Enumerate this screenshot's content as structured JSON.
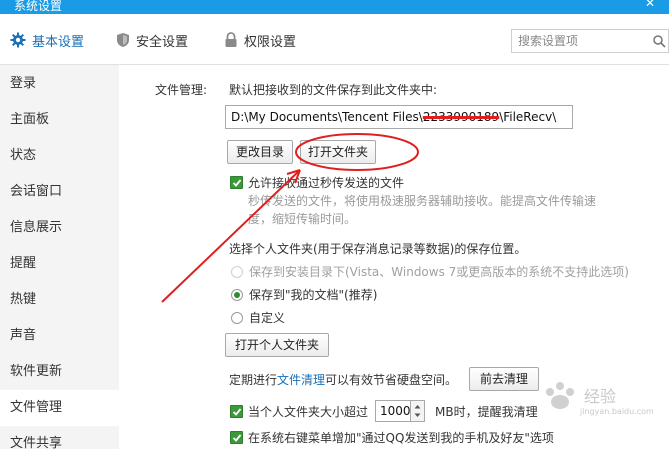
{
  "window": {
    "title": "系统设置",
    "close_glyph": "✕"
  },
  "tabs": [
    {
      "label": "基本设置",
      "icon": "gear-icon",
      "active": true
    },
    {
      "label": "安全设置",
      "icon": "shield-icon",
      "active": false
    },
    {
      "label": "权限设置",
      "icon": "lock-icon",
      "active": false
    }
  ],
  "search": {
    "placeholder": "搜索设置项",
    "icon": "search-icon"
  },
  "sidebar": {
    "items": [
      {
        "label": "登录"
      },
      {
        "label": "主面板"
      },
      {
        "label": "状态"
      },
      {
        "label": "会话窗口"
      },
      {
        "label": "信息展示"
      },
      {
        "label": "提醒"
      },
      {
        "label": "热键"
      },
      {
        "label": "声音"
      },
      {
        "label": "软件更新"
      },
      {
        "label": "文件管理",
        "active": true
      },
      {
        "label": "文件共享"
      }
    ]
  },
  "file_management": {
    "section_label": "文件管理:",
    "save_desc": "默认把接收到的文件保存到此文件夹中:",
    "path_prefix": "D:\\My Documents\\Tencent Files\\",
    "path_hidden": "2233990189",
    "path_suffix": "\\FileRecv\\",
    "change_dir_button": "更改目录",
    "open_folder_button": "打开文件夹",
    "allow_fast_label": "允许接收通过秒传发送的文件",
    "allow_fast_checked": true,
    "allow_fast_desc_1": "秒传发送的文件，将使用极速服务器辅助接收。能提高文件传输速",
    "allow_fast_desc_2": "度，缩短传输时间。",
    "personal_folder_title": "选择个人文件夹(用于保存消息记录等数据)的保存位置。",
    "options": [
      {
        "label": "保存到安装目录下(Vista、Windows 7或更高版本的系统不支持此选项)",
        "disabled": true,
        "selected": false
      },
      {
        "label": "保存到\"我的文档\"(推荐)",
        "disabled": false,
        "selected": true
      },
      {
        "label": "自定义",
        "disabled": false,
        "selected": false
      }
    ],
    "open_personal_button": "打开个人文件夹",
    "cleanup_prefix": "定期进行",
    "cleanup_link": "文件清理",
    "cleanup_suffix": "可以有效节省硬盘空间。",
    "cleanup_button": "前去清理",
    "size_limit_prefix": "当个人文件夹大小超过",
    "size_limit_value": "1000",
    "size_limit_suffix": "MB时，提醒我清理",
    "size_limit_checked": true,
    "context_menu_label": "在系统右键菜单增加\"通过QQ发送到我的手机及好友\"选项",
    "context_menu_checked": true
  },
  "watermark": {
    "text": "Baidu 经验",
    "url": "jingyan.baidu.com"
  },
  "colors": {
    "accent": "#1a9be6",
    "annotation": "#e02020",
    "check_green": "#3a9a3a"
  }
}
